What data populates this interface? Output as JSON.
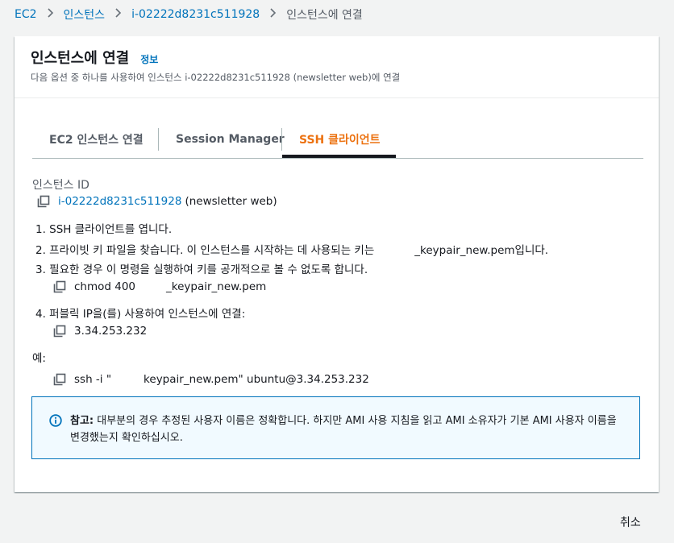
{
  "breadcrumb": {
    "items": [
      "EC2",
      "인스턴스",
      "i-02222d8231c511928"
    ],
    "current": "인스턴스에 연결"
  },
  "header": {
    "title": "인스턴스에 연결",
    "info": "정보",
    "description": "다음 옵션 중 하나를 사용하여 인스턴스 i-02222d8231c511928 (newsletter web)에 연결"
  },
  "tabs": [
    {
      "label": "EC2 인스턴스 연결",
      "active": false
    },
    {
      "label": "Session Manager",
      "active": false
    },
    {
      "label": "SSH 클라이언트",
      "active": true
    }
  ],
  "instance": {
    "label": "인스턴스 ID",
    "id": "i-02222d8231c511928",
    "name": "(newsletter web)"
  },
  "steps": {
    "s1": "1. SSH 클라이언트를 엽니다.",
    "s2_prefix": "2. 프라이빗 키 파일을 찾습니다. 이 인스턴스를 시작하는 데 사용되는 키는",
    "s2_suffix": "_keypair_new.pem입니다.",
    "s3": "3. 필요한 경우 이 명령을 실행하여 키를 공개적으로 볼 수 없도록 합니다.",
    "s3_cmd_prefix": "chmod 400",
    "s3_cmd_suffix": "_keypair_new.pem",
    "s4": "4. 퍼블릭 IP을(를) 사용하여 인스턴스에 연결:",
    "s4_ip": "3.34.253.232"
  },
  "example": {
    "label": "예:",
    "cmd_prefix": "ssh -i \"",
    "cmd_suffix": "keypair_new.pem\" ubuntu@3.34.253.232"
  },
  "alert": {
    "bold": "참고:",
    "text": " 대부분의 경우 추정된 사용자 이름은 정확합니다. 하지만 AMI 사용 지침을 읽고 AMI 소유자가 기본 AMI 사용자 이름을 변경했는지 확인하십시오."
  },
  "footer": {
    "cancel": "취소"
  },
  "colors": {
    "link": "#0073bb",
    "active_tab": "#ec7211",
    "alert_border": "#0073bb",
    "alert_bg": "#f1faff"
  },
  "icons": {
    "copy": "copy-icon",
    "info": "info-circle-icon",
    "separator": "chevron-right-icon"
  }
}
